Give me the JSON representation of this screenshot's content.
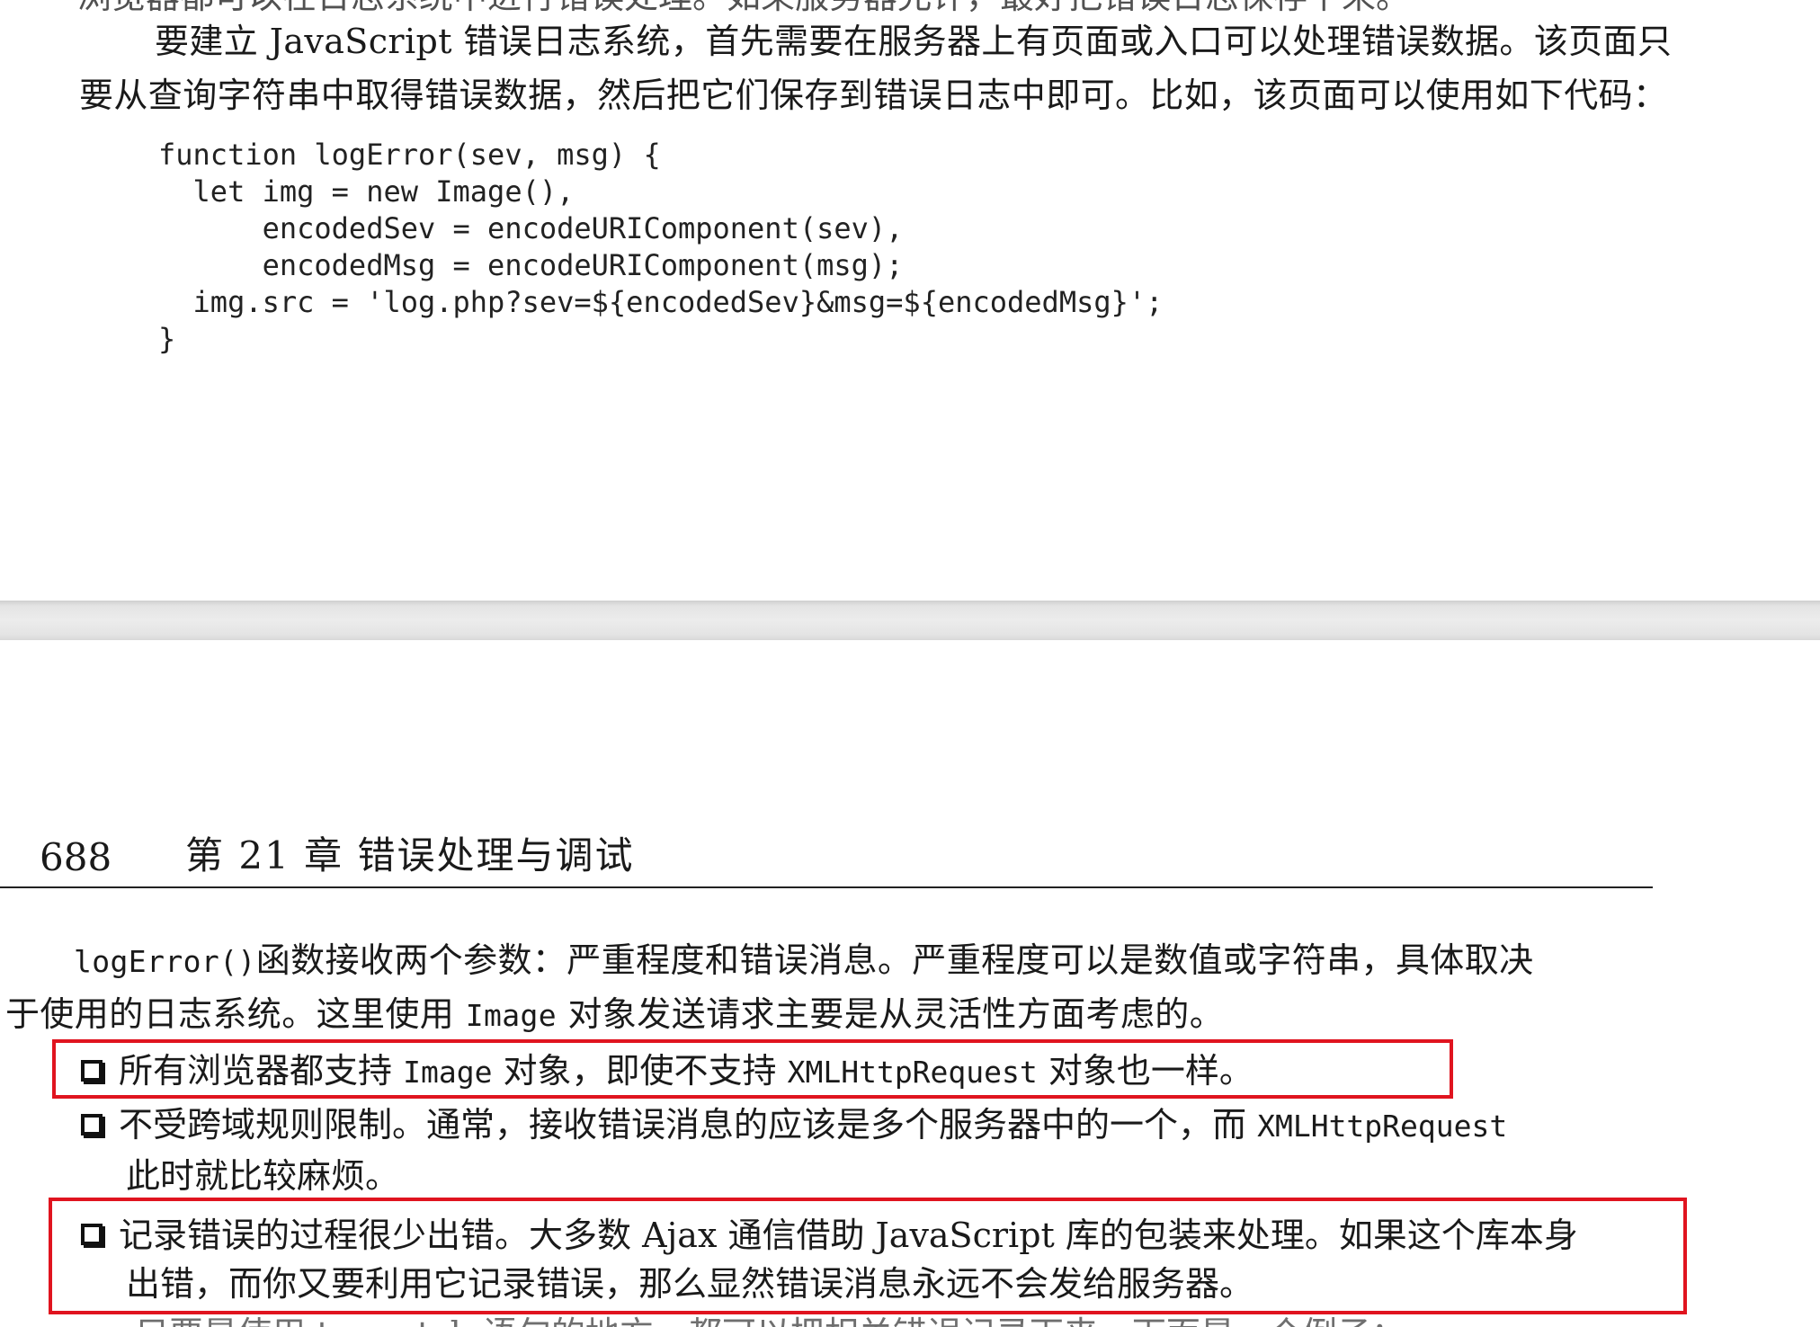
{
  "top_page": {
    "partial_top_line": "浏览器都可以在日志系统中进行错误处理。如果服务器允许，最好把错误日志保存下来。",
    "para1_line1_a": "要建立 ",
    "para1_line1_code": "JavaScript",
    "para1_line1_b": " 错误日志系统，首先需要在服务器上有页面或入口可以处理错误数据。该页面只",
    "para1_line2": "要从查询字符串中取得错误数据，然后把它们保存到错误日志中即可。比如，该页面可以使用如下代码：",
    "code_lines": [
      "function logError(sev, msg) {",
      "  let img = new Image(),",
      "      encodedSev = encodeURIComponent(sev),",
      "      encodedMsg = encodeURIComponent(msg);",
      "  img.src = 'log.php?sev=${encodedSev}&msg=${encodedMsg}';",
      "}"
    ]
  },
  "bottom_page": {
    "page_number": "688",
    "chapter_title": "第 21 章    错误处理与调试",
    "para2_line1_code": "logError()",
    "para2_line1_text": "函数接收两个参数：严重程度和错误消息。严重程度可以是数值或字符串，具体取决",
    "para2_line2_a": "于使用的日志系统。这里使用 ",
    "para2_line2_code": "Image",
    "para2_line2_b": " 对象发送请求主要是从灵活性方面考虑的。",
    "bullets": [
      {
        "a": "所有浏览器都支持 ",
        "code1": "Image",
        "b": " 对象，即使不支持 ",
        "code2": "XMLHttpRequest",
        "c": " 对象也一样。",
        "highlighted": true
      },
      {
        "a": "不受跨域规则限制。通常，接收错误消息的应该是多个服务器中的一个，而 ",
        "code1": "XMLHttpRequest",
        "cont": "此时就比较麻烦。",
        "highlighted": false
      },
      {
        "a": "记录错误的过程很少出错。大多数 Ajax 通信借助 JavaScript 库的包装来处理。如果这个库本身",
        "cont": "出错，而你又要利用它记录错误，那么显然错误消息永远不会发给服务器。",
        "highlighted": true
      }
    ],
    "partial_bottom_line": "只要是使用 try-catch 语句的地方，都可以把相关错误记录下来。下面是一个例子："
  },
  "colors": {
    "highlight_border": "#e0141f",
    "separator": "#e4e4e4",
    "text": "#1a1a1a"
  }
}
